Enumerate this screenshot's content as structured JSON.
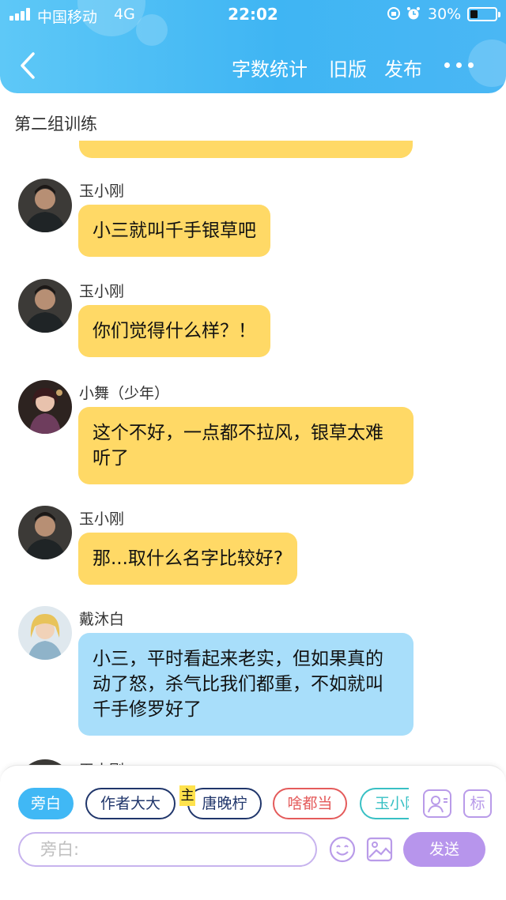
{
  "status_bar": {
    "carrier": "中国移动",
    "network": "4G",
    "time": "22:02",
    "battery_percent": "30%",
    "battery_level": 0.3
  },
  "header": {
    "word_count_label": "字数统计",
    "old_version_label": "旧版",
    "publish_label": "发布",
    "accent_color": "#3fb5f3"
  },
  "page": {
    "title": "第二组训练"
  },
  "messages": [
    {
      "name": "玉小刚",
      "text": "小三就叫千手银草吧",
      "avatar": "yu-xiaogang-avatar",
      "style": "yellow"
    },
    {
      "name": "玉小刚",
      "text": "你们觉得什么样？！",
      "avatar": "yu-xiaogang-avatar",
      "style": "yellow"
    },
    {
      "name": "小舞（少年）",
      "text": "这个不好，一点都不拉风，银草太难听了",
      "avatar": "xiaowu-avatar",
      "style": "yellow"
    },
    {
      "name": "玉小刚",
      "text": "那...取什么名字比较好?",
      "avatar": "yu-xiaogang-avatar",
      "style": "yellow"
    },
    {
      "name": "戴沐白",
      "text": "小三，平时看起来老实，但如果真的动了怒，杀气比我们都重，不如就叫千手修罗好了",
      "avatar": "dai-mubai-avatar",
      "style": "blue"
    },
    {
      "name": "玉小刚",
      "avatar": "yu-xiaogang-avatar"
    }
  ],
  "composer": {
    "roles": [
      "旁白",
      "作者大大",
      "唐晚柠",
      "啥都当",
      "玉小刚"
    ],
    "main_badge": "主",
    "tag_label": "标",
    "placeholder": "旁白:",
    "send_label": "发送"
  }
}
